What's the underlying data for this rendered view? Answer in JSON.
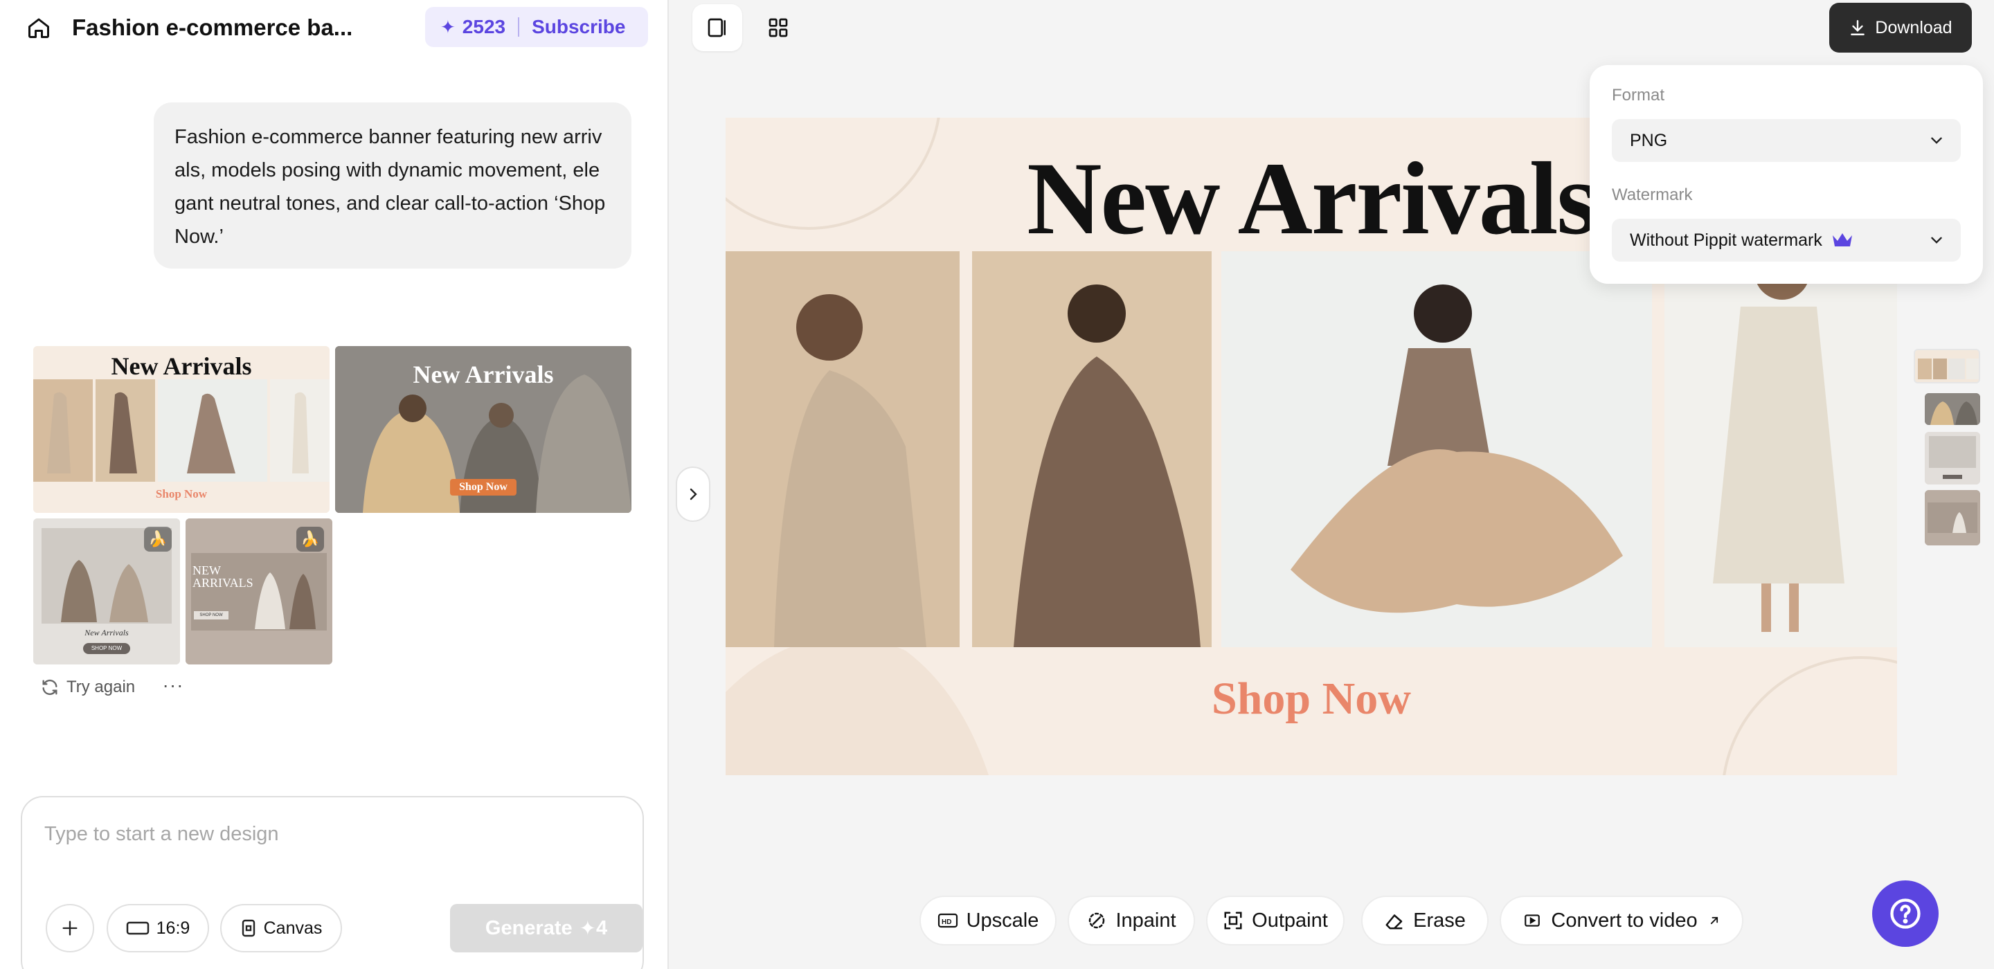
{
  "header": {
    "project_title": "Fashion e-commerce ba...",
    "credits_count": "2523",
    "subscribe_label": "Subscribe"
  },
  "chat": {
    "prompt_text": "Fashion e-commerce banner featuring new arrivals, models posing with dynamic movement, elegant neutral tones, and clear call-to-action ‘Shop Now.’",
    "results": [
      {
        "title": "New Arrivals",
        "cta": "Shop Now"
      },
      {
        "title": "New Arrivals",
        "cta": "Shop Now"
      },
      {
        "title": "New Arrivals",
        "cta": "SHOP NOW"
      },
      {
        "title": "NEW ARRIVALS",
        "cta": "SHOP NOW"
      }
    ],
    "try_again_label": "Try again",
    "more_label": "···"
  },
  "composer": {
    "placeholder": "Type to start a new design",
    "value": "",
    "ratio_label": "16:9",
    "canvas_label": "Canvas",
    "generate_label": "Generate",
    "generate_cost": "4"
  },
  "toolbar_top": {
    "download_label": "Download"
  },
  "download_popover": {
    "format_label": "Format",
    "format_value": "PNG",
    "watermark_label": "Watermark",
    "watermark_value": "Without Pippit watermark"
  },
  "canvas": {
    "banner_title": "New Arrivals",
    "banner_cta": "Shop Now"
  },
  "edit_tools": {
    "upscale": "Upscale",
    "inpaint": "Inpaint",
    "outpaint": "Outpaint",
    "erase": "Erase",
    "convert": "Convert to video"
  },
  "colors": {
    "accent": "#5b45e0",
    "download_bg": "#2c2c2c",
    "cta_color": "#e9866a",
    "banner_bg": "#f7ede4"
  },
  "icons": [
    "home-icon",
    "sparkle-icon",
    "panel-icon",
    "grid-icon",
    "download-icon",
    "chevron-down-icon",
    "crown-icon",
    "chevron-right-icon",
    "refresh-icon",
    "plus-icon",
    "aspect-ratio-icon",
    "canvas-icon",
    "hd-icon",
    "inpaint-icon",
    "outpaint-icon",
    "eraser-icon",
    "video-icon",
    "external-arrow-icon",
    "help-icon",
    "banana-icon"
  ]
}
